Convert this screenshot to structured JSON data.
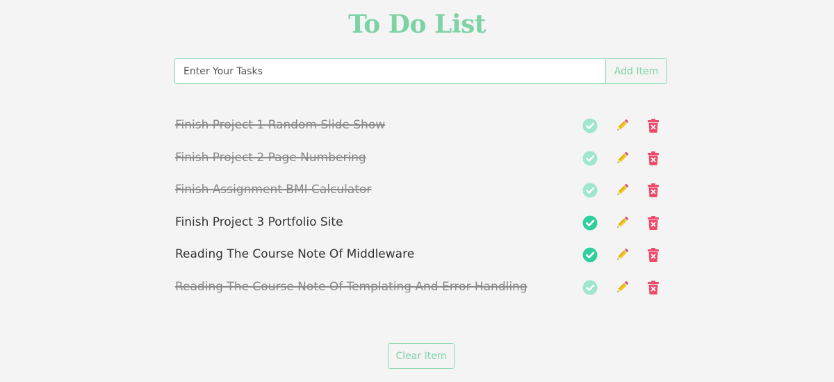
{
  "header": {
    "title": "To Do List"
  },
  "form": {
    "input_placeholder": "Enter Your Tasks",
    "input_value": "",
    "add_label": "Add Item"
  },
  "tasks": [
    {
      "text": "Finish Project 1 Random Slide Show",
      "completed": true
    },
    {
      "text": "Finish Project 2 Page Numbering",
      "completed": true
    },
    {
      "text": "Finish Assignment BMI Calculator",
      "completed": true
    },
    {
      "text": "Finish Project 3 Portfolio Site",
      "completed": false
    },
    {
      "text": "Reading The Course Note Of Middleware",
      "completed": false
    },
    {
      "text": "Reading The Course Note Of Templating And Error Handling",
      "completed": true
    }
  ],
  "icons": {
    "check": "check-circle-icon",
    "edit": "pencil-icon",
    "delete": "trash-icon"
  },
  "colors": {
    "accent": "#7dd3a6",
    "check_active": "#2fcf9e",
    "check_done": "#9ee6cf",
    "delete": "#ee4c6a",
    "pencil": "#f5c518"
  },
  "footer": {
    "clear_label": "Clear Item"
  }
}
